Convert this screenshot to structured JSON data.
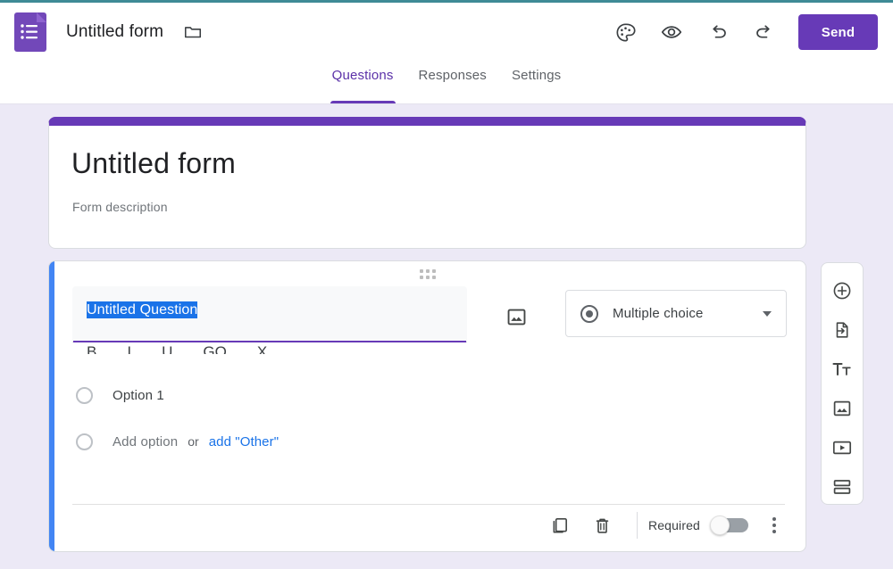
{
  "header": {
    "logo_icon": "google-forms-logo-icon",
    "doc_title": "Untitled form",
    "folder_icon": "folder-icon",
    "theme_label": "Customize theme",
    "theme_icon": "palette-icon",
    "preview_label": "Preview",
    "preview_icon": "eye-icon",
    "undo_label": "Undo",
    "undo_icon": "undo-arrow-icon",
    "redo_label": "Redo",
    "redo_icon": "redo-arrow-icon",
    "send_label": "Send"
  },
  "tabs": [
    {
      "label": "Questions",
      "active": true
    },
    {
      "label": "Responses",
      "active": false
    },
    {
      "label": "Settings",
      "active": false
    }
  ],
  "form_card": {
    "title": "Untitled form",
    "description": "Form description",
    "accent_color": "#673ab7"
  },
  "question_card": {
    "accent_color": "#4285f4",
    "drag_handle_icon": "drag-handle-dots-icon",
    "title_text": "Untitled Question",
    "title_selected": true,
    "selection_color": "#1a73e8",
    "focus_underline_color": "#673ab7",
    "format_toolbar": [
      "B",
      "I",
      "U",
      "GO",
      "X"
    ],
    "image_button_icon": "add-image-icon",
    "type_selector": {
      "icon": "radio-button-icon",
      "value": "Multiple choice",
      "caret_icon": "chevron-down-icon"
    },
    "options": [
      {
        "label": "Option 1",
        "placeholder": false
      }
    ],
    "add_option": {
      "label": "Add option",
      "or_text": "or",
      "other_label": "add \"Other\"",
      "other_color": "#1a73e8"
    },
    "footer": {
      "duplicate_label": "Duplicate",
      "duplicate_icon": "duplicate-icon",
      "delete_label": "Delete",
      "delete_icon": "trash-icon",
      "required_label": "Required",
      "required_on": false,
      "more_label": "More options",
      "more_icon": "kebab-menu-icon"
    }
  },
  "side_toolbar": [
    {
      "name": "add-question",
      "icon": "plus-circle-icon",
      "label": "Add question"
    },
    {
      "name": "import-questions",
      "icon": "import-file-icon",
      "label": "Import questions"
    },
    {
      "name": "add-title-description",
      "icon": "title-text-icon",
      "label": "Add title and description"
    },
    {
      "name": "add-image",
      "icon": "image-icon",
      "label": "Add image"
    },
    {
      "name": "add-video",
      "icon": "video-play-icon",
      "label": "Add video"
    },
    {
      "name": "add-section",
      "icon": "section-split-icon",
      "label": "Add section"
    }
  ],
  "colors": {
    "page_background": "#ece9f6",
    "brand_purple": "#673ab7",
    "link_blue": "#1a73e8"
  }
}
